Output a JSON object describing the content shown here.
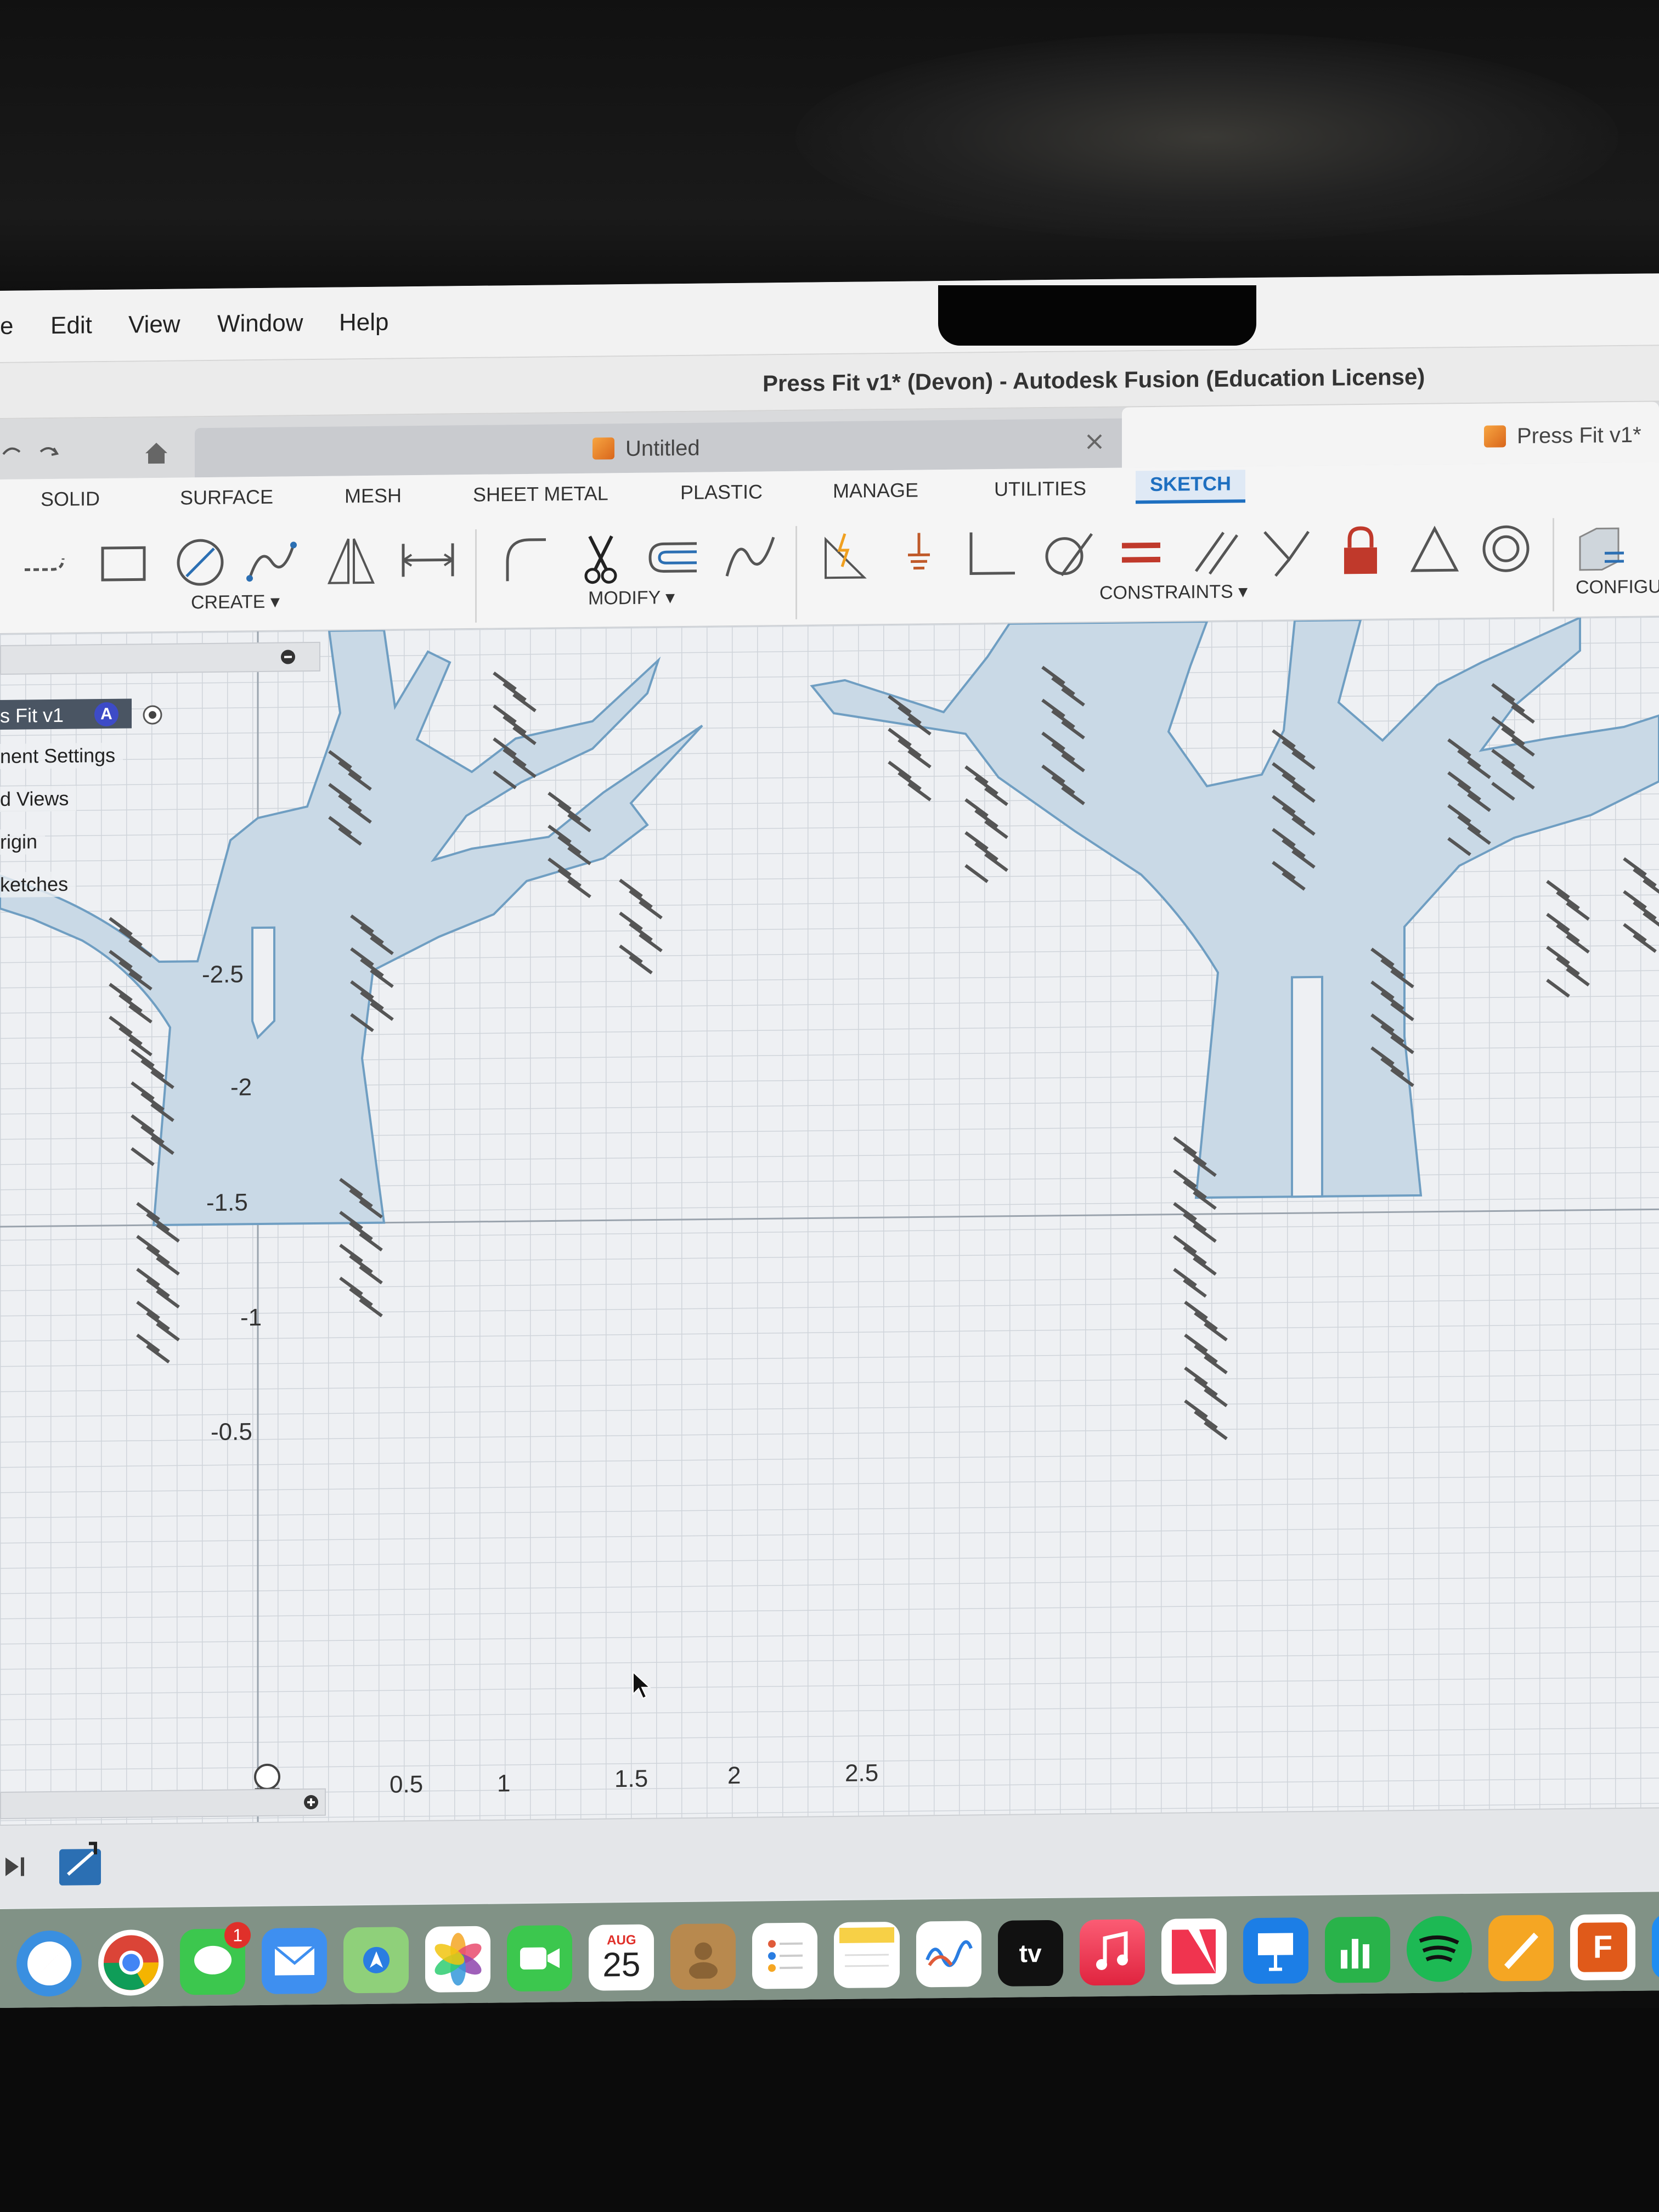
{
  "menubar": {
    "items": [
      "e",
      "Edit",
      "View",
      "Window",
      "Help"
    ]
  },
  "window": {
    "title": "Press Fit v1* (Devon) - Autodesk Fusion (Education License)"
  },
  "tabs": [
    {
      "label": "Untitled"
    },
    {
      "label": "Press Fit v1*"
    }
  ],
  "workspace_tabs": [
    "SOLID",
    "SURFACE",
    "MESH",
    "SHEET METAL",
    "PLASTIC",
    "MANAGE",
    "UTILITIES",
    "SKETCH"
  ],
  "active_workspace": "SKETCH",
  "tool_groups": {
    "create": "CREATE ▾",
    "modify": "MODIFY ▾",
    "constraints": "CONSTRAINTS ▾",
    "configure": "CONFIGU"
  },
  "browser": {
    "root": "s Fit v1",
    "items": [
      "nent Settings",
      "d Views",
      "rigin",
      "ketches"
    ]
  },
  "axes": {
    "y_ticks": [
      "-2.5",
      "-2",
      "-1.5",
      "-1",
      "-0.5"
    ],
    "x_ticks": [
      "0.5",
      "1",
      "1.5",
      "2",
      "2.5"
    ]
  },
  "dock": {
    "calendar_month": "AUG",
    "calendar_day": "25",
    "messages_badge": "1",
    "tv_label": "tv",
    "fusion_label": "F"
  },
  "colors": {
    "accent": "#1e6fc0",
    "sketch_fill": "#c9d9e6",
    "sketch_stroke": "#6f9ec2",
    "lock_red": "#c0392b"
  }
}
